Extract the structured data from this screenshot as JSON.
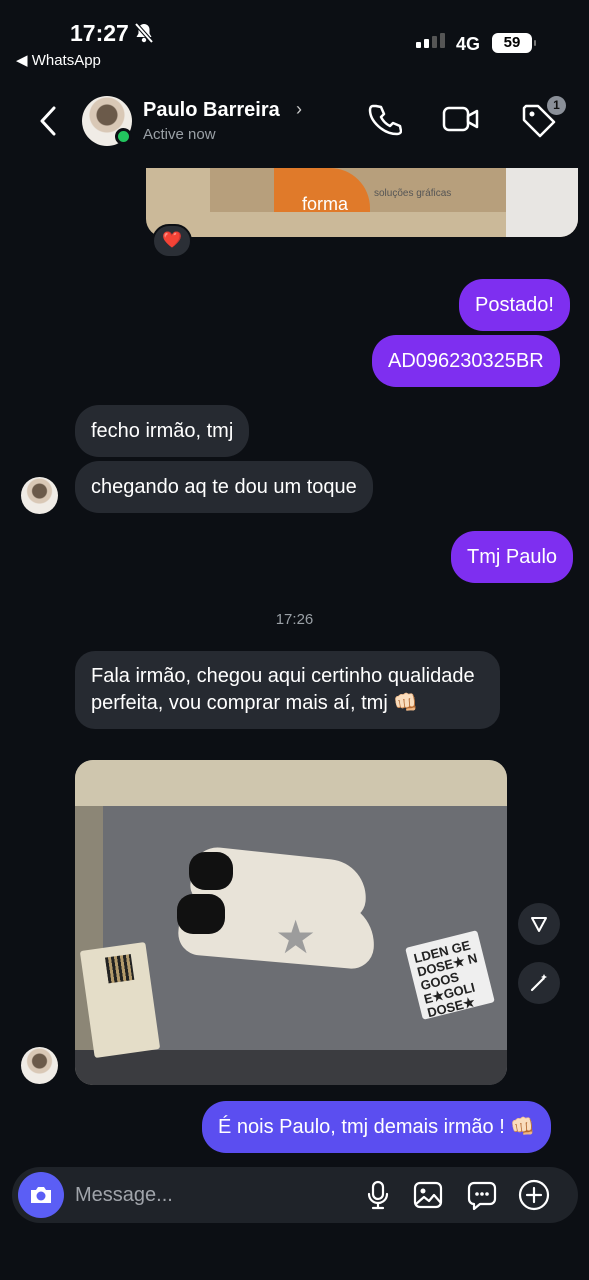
{
  "status_bar": {
    "time": "17:27",
    "back_app": "◀ WhatsApp",
    "network": "4G",
    "battery": "59"
  },
  "header": {
    "name": "Paulo Barreira",
    "status": "Active now",
    "badge_count": "1"
  },
  "messages": {
    "m1": "Postado!",
    "m2": "AD096230325BR",
    "m3": "fecho irmão, tmj",
    "m4": "chegando aq te dou um toque",
    "m5": "Tmj Paulo",
    "timestamp": "17:26",
    "m6": "Fala irmão, chegou aqui certinho qualidade perfeita, vou comprar mais aí, tmj 👊🏻",
    "m7": "É nois Paulo, tmj demais irmão ! 👊🏻"
  },
  "reaction": "❤️",
  "photo_top": {
    "brand": "forma",
    "brand_sub": "soluções gráficas"
  },
  "photo_card_text": "LDEN GE DOSE★ N GOOS E★GOLI DOSE★",
  "composer": {
    "placeholder": "Message..."
  },
  "colors": {
    "outgoing": "#7e2ff0",
    "outgoing_last": "#5b4ef0",
    "incoming": "#262a31",
    "background": "#0c0f14",
    "camera": "#5b5ef5",
    "active": "#22c55e"
  }
}
